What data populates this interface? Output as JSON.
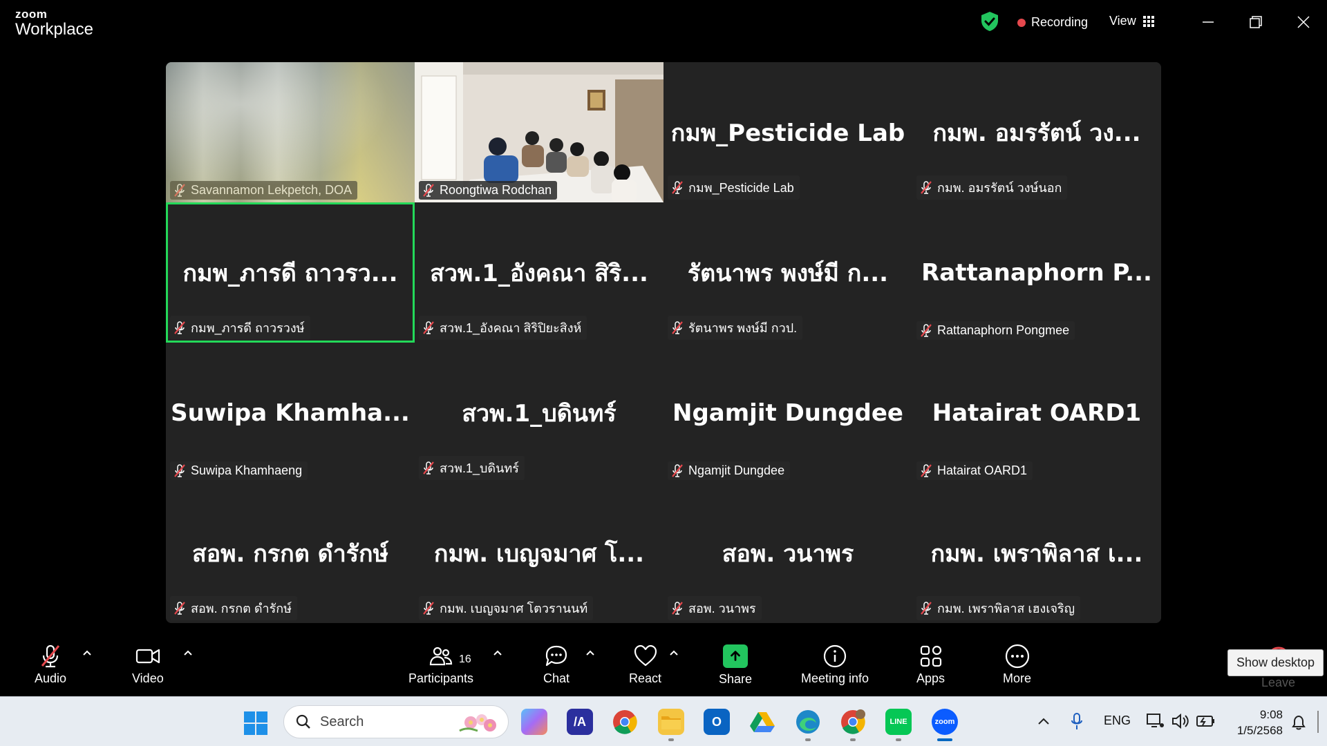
{
  "titlebar": {
    "logo_top": "zoom",
    "logo_bottom": "Workplace",
    "recording_label": "Recording",
    "view_label": "View"
  },
  "tiles": [
    {
      "big": "",
      "name": "Savannamon Lekpetch, DOA",
      "kind": "photo-blur"
    },
    {
      "big": "",
      "name": "Roongtiwa Rodchan",
      "kind": "photo-room"
    },
    {
      "big": "กมพ_Pesticide  Lab",
      "name": "กมพ_Pesticide Lab",
      "kind": "text"
    },
    {
      "big": "กมพ. อมรรัตน์ วง...",
      "name": "กมพ. อมรรัตน์ วงษ์นอก",
      "kind": "text"
    },
    {
      "big": "กมพ_ภารดี ถาวรว...",
      "name": "กมพ_ภารดี ถาวรวงษ์",
      "kind": "text",
      "active": true
    },
    {
      "big": "สวพ.1_อังคณา สิริ...",
      "name": "สวพ.1_อังคณา สิริปิยะสิงห์",
      "kind": "text"
    },
    {
      "big": "รัตนาพร พงษ์มี ก...",
      "name": "รัตนาพร พงษ์มี กวป.",
      "kind": "text"
    },
    {
      "big": "Rattanaphorn  P...",
      "name": "Rattanaphorn Pongmee",
      "kind": "text"
    },
    {
      "big": "Suwipa  Khamha...",
      "name": "Suwipa Khamhaeng",
      "kind": "text"
    },
    {
      "big": "สวพ.1_บดินทร์",
      "name": "สวพ.1_บดินทร์",
      "kind": "text"
    },
    {
      "big": "Ngamjit Dungdee",
      "name": "Ngamjit Dungdee",
      "kind": "text"
    },
    {
      "big": "Hatairat OARD1",
      "name": "Hatairat OARD1",
      "kind": "text"
    },
    {
      "big": "สอพ. กรกต ดำรักษ์",
      "name": "สอพ. กรกต ดำรักษ์",
      "kind": "text"
    },
    {
      "big": "กมพ. เบญจมาศ โ...",
      "name": "กมพ. เบญจมาศ โตวรานนท์",
      "kind": "text"
    },
    {
      "big": "สอพ. วนาพร",
      "name": "สอพ. วนาพร",
      "kind": "text"
    },
    {
      "big": "กมพ. เพราพิลาส เ...",
      "name": "กมพ. เพราพิลาส เฮงเจริญ",
      "kind": "text"
    }
  ],
  "toolbar": {
    "audio": "Audio",
    "video": "Video",
    "participants": "Participants",
    "participants_count": "16",
    "chat": "Chat",
    "react": "React",
    "share": "Share",
    "meeting_info": "Meeting info",
    "apps": "Apps",
    "more": "More",
    "leave": "Leave",
    "show_desktop_tooltip": "Show desktop"
  },
  "taskbar": {
    "search_placeholder": "Search",
    "lang": "ENG",
    "time": "9:08",
    "date": "1/5/2568",
    "zoom_app_label": "zoom"
  },
  "colors": {
    "active_speaker": "#23d959",
    "recording_dot": "#e5484d",
    "share_green": "#22c55e",
    "muted_red": "#e5484d"
  }
}
